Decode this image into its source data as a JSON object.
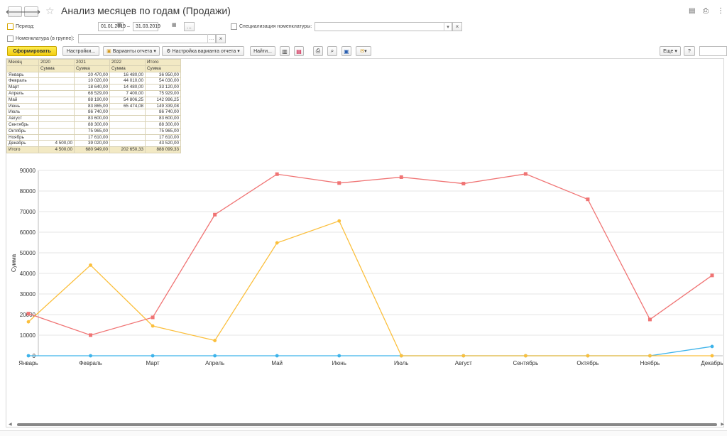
{
  "header": {
    "title": "Анализ месяцев по годам (Продажи)",
    "back_icon": "arrow-left-icon",
    "forward_icon": "arrow-right-icon",
    "star_icon": "star-icon"
  },
  "filters": {
    "period_label": "Период:",
    "period_from": "01.01.2019",
    "period_dash": "–",
    "period_to": "31.03.2019",
    "period_more": "...",
    "spec_label": "Специализация номенклатуры:",
    "nomenclature_label": "Номенклатура (в группе):",
    "dropdown_arrow": "▾",
    "clear_x": "×",
    "calendar_icon": "calendar-icon"
  },
  "toolbar": {
    "generate": "Сформировать",
    "settings": "Настройки...",
    "variants": "Варианты отчета",
    "variant_settings": "Настройка варианта отчета",
    "find": "Найти...",
    "more": "Еще",
    "help": "?"
  },
  "table": {
    "header1": [
      "Месяц",
      "2020",
      "2021",
      "2022",
      "Итого"
    ],
    "header2": [
      "",
      "Сумма",
      "Сумма",
      "Сумма",
      "Сумма"
    ],
    "rows": [
      [
        "Январь",
        "",
        "20 470,00",
        "16 480,00",
        "36 950,00"
      ],
      [
        "Февраль",
        "",
        "10 020,00",
        "44 010,00",
        "54 030,00"
      ],
      [
        "Март",
        "",
        "18 640,00",
        "14 480,00",
        "33 120,00"
      ],
      [
        "Апрель",
        "",
        "68 529,00",
        "7 400,00",
        "75 929,00"
      ],
      [
        "Май",
        "",
        "88 190,00",
        "54 806,25",
        "142 996,25"
      ],
      [
        "Июнь",
        "",
        "83 865,00",
        "65 474,08",
        "149 339,08"
      ],
      [
        "Июль",
        "",
        "86 740,00",
        "",
        "86 740,00"
      ],
      [
        "Август",
        "",
        "83 600,00",
        "",
        "83 600,00"
      ],
      [
        "Сентябрь",
        "",
        "88 300,00",
        "",
        "88 300,00"
      ],
      [
        "Октябрь",
        "",
        "75 965,00",
        "",
        "75 965,00"
      ],
      [
        "Ноябрь",
        "",
        "17 610,00",
        "",
        "17 610,00"
      ],
      [
        "Декабрь",
        "4 500,00",
        "39 020,00",
        "",
        "43 520,00"
      ]
    ],
    "total": [
      "Итого",
      "4 500,00",
      "680 949,00",
      "202 650,33",
      "888 099,33"
    ]
  },
  "chart_data": {
    "type": "line",
    "categories": [
      "Январь",
      "Февраль",
      "Март",
      "Апрель",
      "Май",
      "Июнь",
      "Июль",
      "Август",
      "Сентябрь",
      "Октябрь",
      "Ноябрь",
      "Декабрь"
    ],
    "ylabel": "Сумма",
    "ylim": [
      0,
      90000
    ],
    "yticks": [
      0,
      10000,
      20000,
      30000,
      40000,
      50000,
      60000,
      70000,
      80000,
      90000
    ],
    "grid": true,
    "series": [
      {
        "color": "#f07474",
        "marker": "square",
        "values": [
          20470,
          10020,
          18640,
          68529,
          88190,
          83865,
          86740,
          83600,
          88300,
          75965,
          17610,
          39020
        ]
      },
      {
        "color": "#fbbf3c",
        "marker": "circle",
        "values": [
          16480,
          44010,
          14480,
          7400,
          54806.25,
          65474.08,
          0,
          0,
          0,
          0,
          0,
          0
        ]
      },
      {
        "color": "#3db3ea",
        "marker": "circle",
        "values": [
          0,
          0,
          0,
          0,
          0,
          0,
          0,
          0,
          0,
          0,
          0,
          4500
        ]
      }
    ]
  }
}
